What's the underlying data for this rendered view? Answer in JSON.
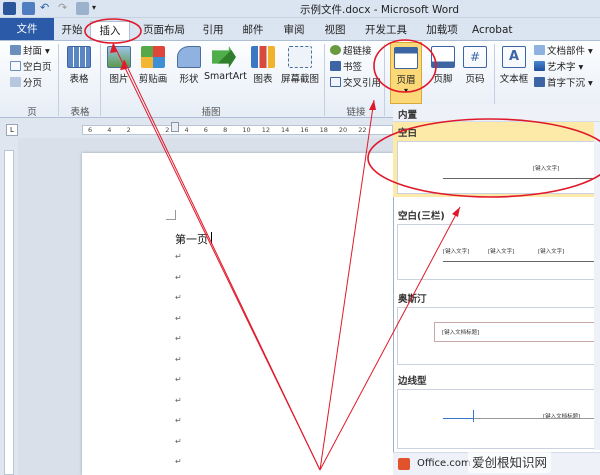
{
  "window": {
    "title": "示例文件.docx - Microsoft Word"
  },
  "tabs": [
    {
      "label": "文件"
    },
    {
      "label": "开始"
    },
    {
      "label": "插入"
    },
    {
      "label": "页面布局"
    },
    {
      "label": "引用"
    },
    {
      "label": "邮件"
    },
    {
      "label": "审阅"
    },
    {
      "label": "视图"
    },
    {
      "label": "开发工具"
    },
    {
      "label": "加载项"
    },
    {
      "label": "Acrobat"
    }
  ],
  "ribbon": {
    "pages": {
      "label": "页",
      "cover": "封面",
      "blank": "空白页",
      "break": "分页"
    },
    "table": {
      "label": "表格",
      "btn": "表格"
    },
    "illustrations": {
      "label": "插图",
      "picture": "图片",
      "clipart": "剪贴画",
      "shapes": "形状",
      "smartart": "SmartArt",
      "chart": "图表",
      "screenshot": "屏幕截图"
    },
    "links": {
      "label": "链接",
      "hyperlink": "超链接",
      "bookmark": "书签",
      "crossref": "交叉引用"
    },
    "header": {
      "btn": "页眉",
      "footer": "页脚",
      "pagenum": "页码"
    },
    "text": {
      "textbox": "文本框",
      "parts": "文档部件",
      "wordart": "艺术字",
      "dropcap": "首字下沉"
    }
  },
  "ruler": {
    "ticks": [
      "6",
      "4",
      "2",
      "",
      "2",
      "4",
      "6",
      "8",
      "10",
      "12",
      "14",
      "16",
      "18",
      "20",
      "22"
    ]
  },
  "document": {
    "first_line": "第一页",
    "para_mark": "↵"
  },
  "gallery": {
    "header": "内置",
    "sections": [
      {
        "label": "空白",
        "placeholders": [
          "[键入文字]"
        ]
      },
      {
        "label": "空白(三栏)",
        "placeholders": [
          "[键入文字]",
          "[键入文字]",
          "[键入文字]"
        ]
      },
      {
        "label": "奥斯汀",
        "placeholders": [
          "[键入文档标题]"
        ]
      },
      {
        "label": "边线型",
        "placeholders": [
          "[键入文档标题]"
        ]
      }
    ],
    "office_online": "Office.com"
  },
  "watermark": "爱创根知识网",
  "colors": {
    "annotation": "#e0192a",
    "file_tab": "#2a5aa8",
    "selected": "#fde9a8"
  }
}
